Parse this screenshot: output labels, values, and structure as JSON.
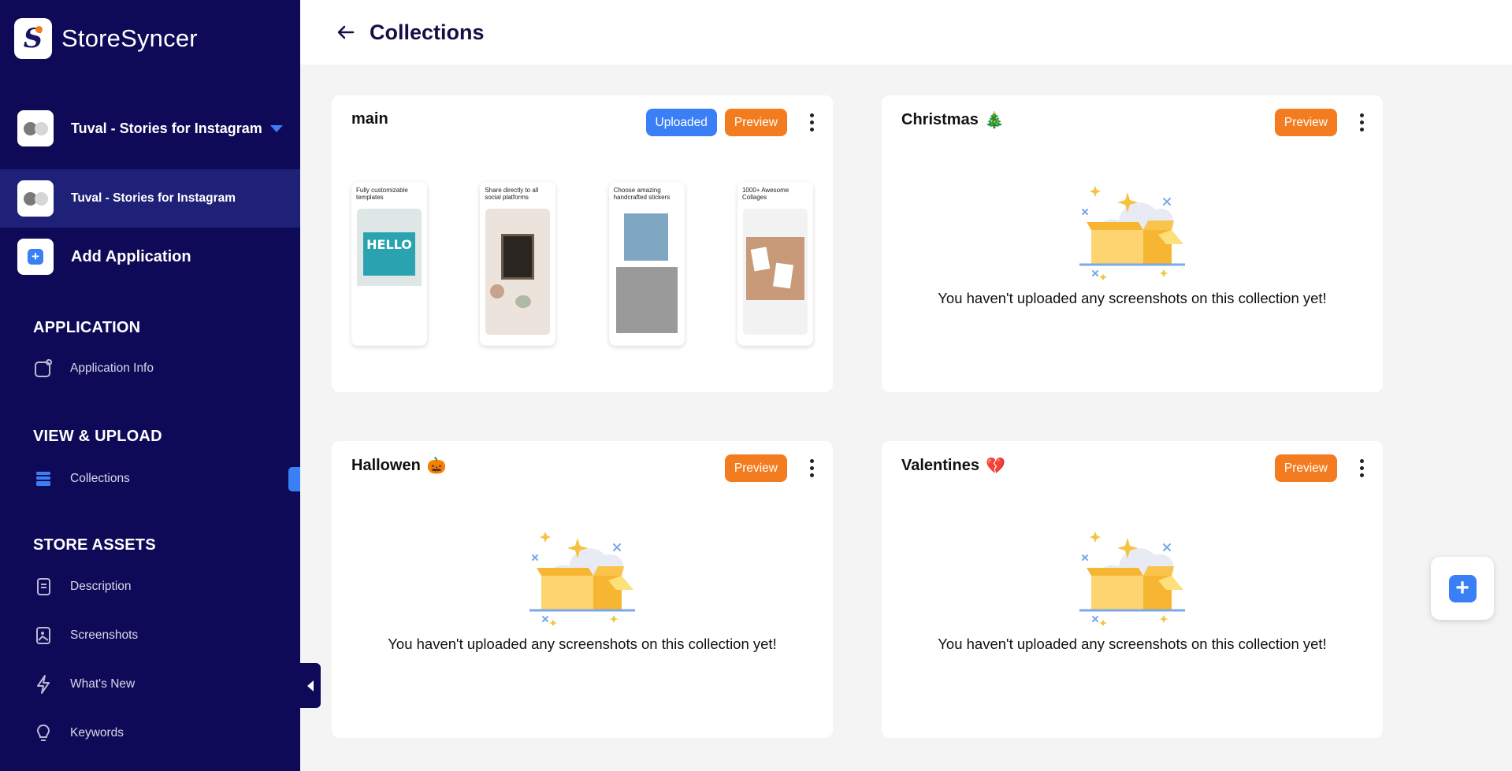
{
  "brand": {
    "name_light": "Store",
    "name_bold": "Syncer"
  },
  "sidebar": {
    "app_selector_name": "Tuval - Stories for Instagram",
    "current_app_name": "Tuval - Stories for Instagram",
    "add_application_label": "Add Application",
    "sections": {
      "application": "APPLICATION",
      "view_upload": "VIEW & UPLOAD",
      "store_assets": "STORE ASSETS"
    },
    "items": {
      "application_info": "Application Info",
      "collections": "Collections",
      "description": "Description",
      "screenshots": "Screenshots",
      "whats_new": "What's New",
      "keywords": "Keywords"
    }
  },
  "header": {
    "title": "Collections"
  },
  "buttons": {
    "uploaded": "Uploaded",
    "preview": "Preview"
  },
  "collections": [
    {
      "name": "main",
      "status": "Uploaded",
      "screenshots": [
        {
          "caption": "Fully customizable templates"
        },
        {
          "caption": "Share directly to all social platforms"
        },
        {
          "caption": "Choose amazing handcrafted stickers"
        },
        {
          "caption": "1000+ Awesome Collages"
        }
      ]
    },
    {
      "name": "Christmas",
      "emoji": "🎄",
      "empty_message": "You haven't uploaded any screenshots on this collection yet!"
    },
    {
      "name": "Hallowen",
      "emoji": "🎃",
      "empty_message": "You haven't uploaded any screenshots on this collection yet!"
    },
    {
      "name": "Valentines",
      "emoji": "💔",
      "empty_message": "You haven't uploaded any screenshots on this collection yet!"
    }
  ],
  "colors": {
    "sidebar_bg": "#0f0a57",
    "sidebar_active": "#1f2178",
    "accent_blue": "#3b7ff6",
    "accent_orange": "#f47c20",
    "page_bg": "#f4f4f4"
  }
}
